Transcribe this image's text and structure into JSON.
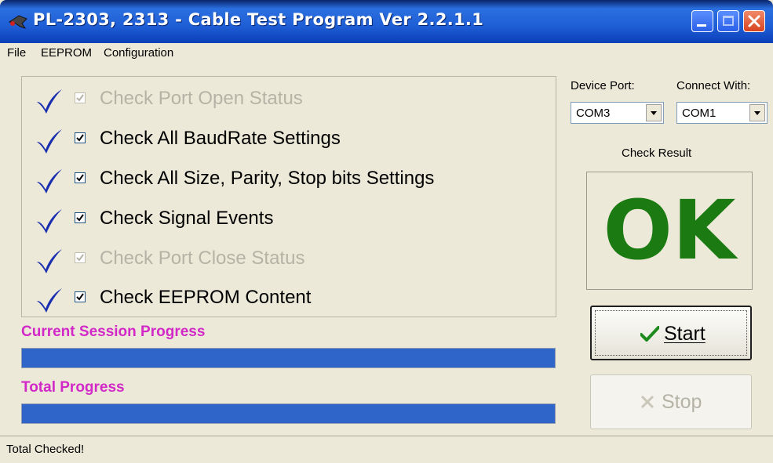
{
  "window": {
    "title": "PL-2303, 2313 - Cable Test Program Ver 2.2.1.1",
    "buttons": [
      "minimize-icon",
      "maximize-icon",
      "close-icon"
    ]
  },
  "menu": {
    "file": "File",
    "eeprom": "EEPROM",
    "configuration": "Configuration"
  },
  "checks": [
    {
      "label": "Check Port Open Status",
      "checked": true,
      "enabled": false
    },
    {
      "label": "Check All BaudRate Settings",
      "checked": true,
      "enabled": true
    },
    {
      "label": "Check All Size, Parity, Stop bits Settings",
      "checked": true,
      "enabled": true
    },
    {
      "label": "Check Signal Events",
      "checked": true,
      "enabled": true
    },
    {
      "label": "Check Port Close Status",
      "checked": true,
      "enabled": false
    },
    {
      "label": "Check EEPROM Content",
      "checked": true,
      "enabled": true
    }
  ],
  "progress": {
    "current_label": "Current Session Progress",
    "current_value": 1.0,
    "total_label": "Total Progress",
    "total_value": 1.0
  },
  "side": {
    "device_port_label": "Device Port:",
    "device_port_value": "COM3",
    "connect_with_label": "Connect With:",
    "connect_with_value": "COM1",
    "check_result_label": "Check Result",
    "result": "OK"
  },
  "buttons": {
    "start": "Start",
    "stop": "Stop"
  },
  "status": {
    "text": "Total Checked!"
  },
  "colors": {
    "title_bar": "#1f5fd6",
    "check_mark": "#1a2fb0",
    "progress_label": "#d228c8",
    "progress_fill": "#2f65c8",
    "ok_text": "#1b7a12",
    "start_check": "#1c8a1c",
    "disabled_text": "#b5b3a6"
  }
}
